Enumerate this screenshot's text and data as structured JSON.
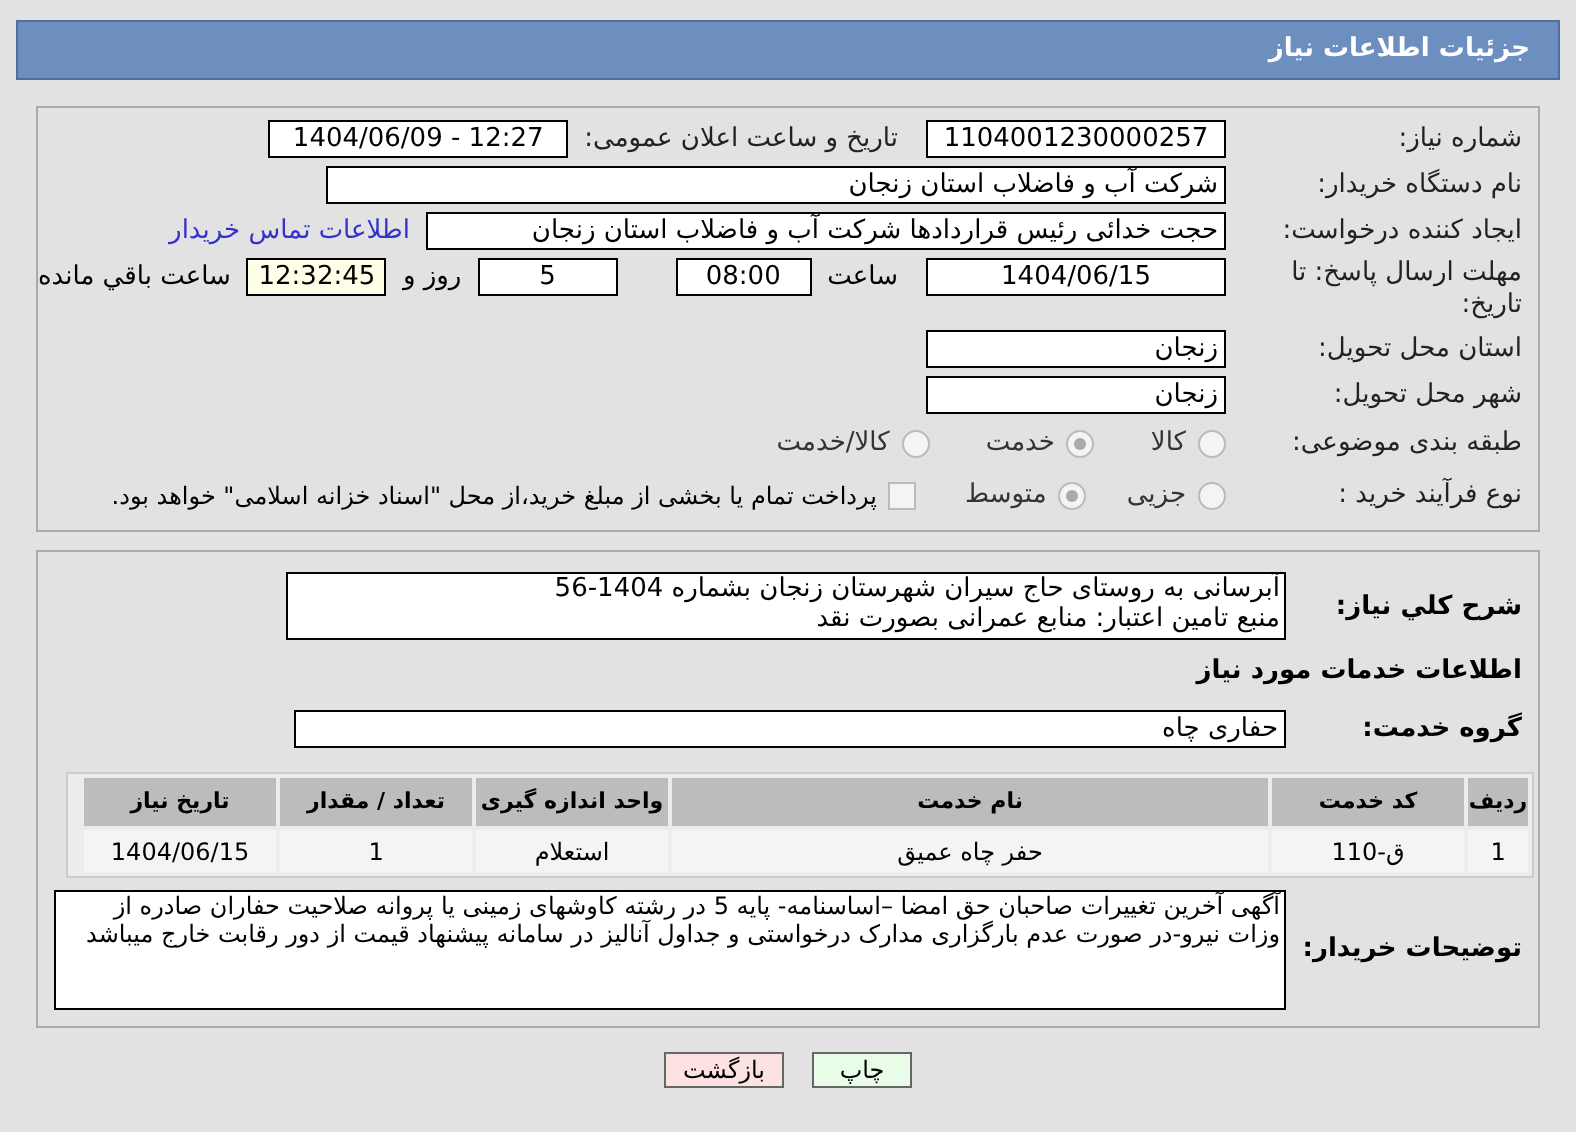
{
  "header": {
    "title": "جزئیات اطلاعات نیاز"
  },
  "details": {
    "need_number": {
      "label": "شماره نیاز:",
      "value": "1104001230000257"
    },
    "announce": {
      "label": "تاریخ و ساعت اعلان عمومی:",
      "value": "1404/06/09 - 12:27"
    },
    "buyer": {
      "label": "نام دستگاه خریدار:",
      "value": "شرکت آب و فاضلاب استان زنجان"
    },
    "creator": {
      "label": "ایجاد کننده درخواست:",
      "value": "حجت  خدائی رئیس قراردادها شرکت آب و فاضلاب استان زنجان",
      "link": "اطلاعات تماس خریدار"
    },
    "deadline": {
      "label": "مهلت ارسال پاسخ: تا تاریخ:",
      "date": "1404/06/15",
      "time_label": "ساعت",
      "time": "08:00",
      "days": "5",
      "days_label": "روز و",
      "remaining": "12:32:45",
      "remaining_label": "ساعت باقي مانده"
    },
    "province": {
      "label": "استان محل تحویل:",
      "value": "زنجان"
    },
    "city": {
      "label": "شهر محل تحویل:",
      "value": "زنجان"
    },
    "category": {
      "label": "طبقه بندی موضوعی:",
      "options": [
        {
          "label": "کالا",
          "selected": false
        },
        {
          "label": "خدمت",
          "selected": true
        },
        {
          "label": "کالا/خدمت",
          "selected": false
        }
      ]
    },
    "process": {
      "label": "نوع فرآیند خرید :",
      "options": [
        {
          "label": "جزیی",
          "selected": false
        },
        {
          "label": "متوسط",
          "selected": true
        }
      ],
      "payment": {
        "label": "پرداخت تمام یا بخشی از مبلغ خرید،از محل \"اسناد خزانه اسلامی\" خواهد بود.",
        "checked": false
      }
    }
  },
  "services": {
    "summary": {
      "label": "شرح کلي نياز:",
      "lines": [
        "آبرسانی به روستای حاج سیران شهرستان زنجان بشماره 1404-56",
        "منبع تامین اعتبار: منابع عمرانی بصورت نقد"
      ]
    },
    "heading": "اطلاعات خدمات مورد نياز",
    "group": {
      "label": "گروه خدمت:",
      "value": "حفاری چاه"
    },
    "table": {
      "columns": [
        "ردیف",
        "کد خدمت",
        "نام خدمت",
        "واحد اندازه گیری",
        "تعداد / مقدار",
        "تاریخ نیاز"
      ],
      "rows": [
        [
          "1",
          "ق-110",
          "حفر چاه عمیق",
          "استعلام",
          "1",
          "1404/06/15"
        ]
      ]
    },
    "notes": {
      "label": "توضیحات خریدار:",
      "value": "آگهی آخرین تغییرات صاحبان حق امضا –اساسنامه- پایه 5 در رشته کاوشهای زمینی یا پروانه صلاحیت حفاران صادره از وزات نیرو-در صورت عدم بارگزاری مدارک درخواستی و جداول آنالیز در سامانه پیشنهاد قیمت از دور رقابت خارج میباشد"
    }
  },
  "buttons": {
    "print": "چاپ",
    "back": "بازگشت"
  }
}
